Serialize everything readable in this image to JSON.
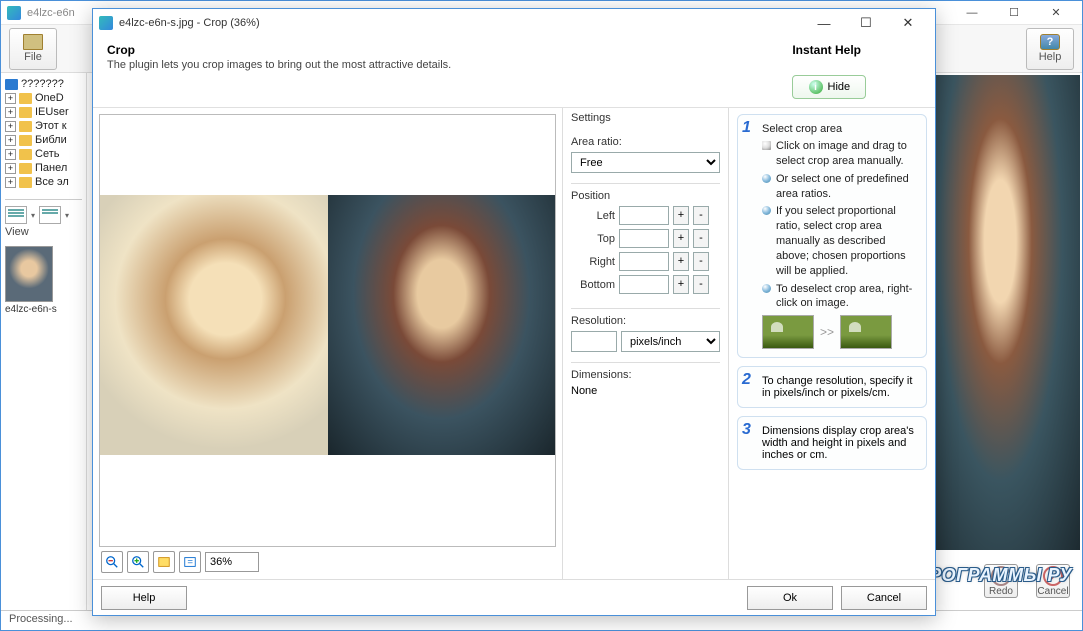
{
  "parent": {
    "title": "e4lzc-e6n",
    "file_label": "File",
    "help_label": "Help",
    "redo_label": "Redo",
    "cancel_label": "Cancel",
    "view_label": "View",
    "status": "Processing...",
    "watermark": "ТВОИ ПРОГРАММЫ РУ",
    "tree": {
      "root": "??????? ",
      "items": [
        "OneD",
        "IEUser",
        "Этот к",
        "Библи",
        "Сеть",
        "Панел",
        "Все эл"
      ]
    },
    "thumb_name": "e4lzc-e6n-s"
  },
  "dialog": {
    "title": "e4lzc-e6n-s.jpg - Crop (36%)",
    "heading": "Crop",
    "subheading": "The plugin lets you crop images to bring out the most attractive details.",
    "instant_help": "Instant Help",
    "hide": "Hide",
    "zoom_value": "36%",
    "settings": {
      "header": "Settings",
      "area_ratio_label": "Area ratio:",
      "area_ratio_value": "Free",
      "position_header": "Position",
      "left": "Left",
      "top": "Top",
      "right": "Right",
      "bottom": "Bottom",
      "plus": "+",
      "minus": "-",
      "resolution_label": "Resolution:",
      "resolution_unit": "pixels/inch",
      "dimensions_label": "Dimensions:",
      "dimensions_value": "None"
    },
    "help": {
      "step1_title": "Select crop area",
      "step1_items": [
        "Click on image and drag to select crop area manually.",
        "Or select one of predefined area ratios.",
        "If you select proportional ratio, select crop area manually as described above; chosen proportions will be applied.",
        "To deselect crop area, right-click on image."
      ],
      "arrow": ">>",
      "step2": "To change resolution, specify it in pixels/inch or pixels/cm.",
      "step3": "Dimensions display crop area's width and height in pixels and inches or cm."
    },
    "footer": {
      "help": "Help",
      "ok": "Ok",
      "cancel": "Cancel"
    }
  }
}
